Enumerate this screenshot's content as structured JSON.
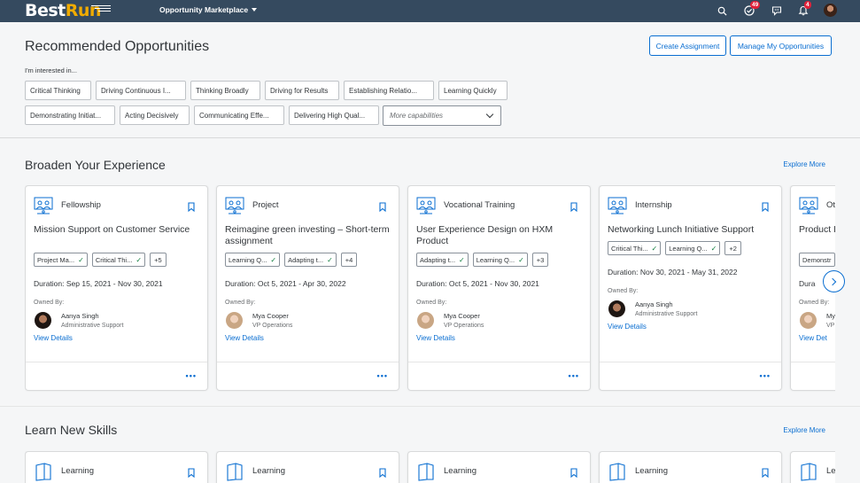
{
  "shell": {
    "logo_best": "Best",
    "logo_run": "Run",
    "app_title": "Opportunity Marketplace",
    "tasks_badge": "49",
    "notifications_badge": "4"
  },
  "recommended": {
    "title": "Recommended Opportunities",
    "create_label": "Create Assignment",
    "manage_label": "Manage My Opportunities",
    "interest_label": "I'm interested in...",
    "chips": [
      "Critical Thinking",
      "Driving Continuous I...",
      "Thinking Broadly",
      "Driving for Results",
      "Establishing Relatio...",
      "Learning Quickly",
      "Demonstrating Initiat...",
      "Acting Decisively",
      "Communicating Effe...",
      "Delivering High Qual..."
    ],
    "more_placeholder": "More capabilities"
  },
  "broaden": {
    "title": "Broaden Your Experience",
    "explore_label": "Explore More",
    "cards": [
      {
        "type": "Fellowship",
        "title": "Mission Support on Customer Service",
        "tags": [
          "Project Ma...",
          "Critical Thi..."
        ],
        "more": "+5",
        "duration": "Duration: Sep 15, 2021 - Nov 30, 2021",
        "owned_by": "Owned By:",
        "owner": "Aanya Singh",
        "role": "Administrative Support",
        "view": "View Details"
      },
      {
        "type": "Project",
        "title": "Reimagine green investing – Short-term assignment",
        "tags": [
          "Learning Q...",
          "Adapting t..."
        ],
        "more": "+4",
        "duration": "Duration: Oct 5, 2021 - Apr 30, 2022",
        "owned_by": "Owned By:",
        "owner": "Mya Cooper",
        "role": "VP Operations",
        "view": "View Details"
      },
      {
        "type": "Vocational Training",
        "title": "User Experience Design on HXM Product",
        "tags": [
          "Adapting t...",
          "Learning Q..."
        ],
        "more": "+3",
        "duration": "Duration: Oct 5, 2021 - Nov 30, 2021",
        "owned_by": "Owned By:",
        "owner": "Mya Cooper",
        "role": "VP Operations",
        "view": "View Details"
      },
      {
        "type": "Internship",
        "title": "Networking Lunch Initiative Support",
        "tags": [
          "Critical Thi...",
          "Learning Q..."
        ],
        "more": "+2",
        "duration": "Duration: Nov 30, 2021 - May 31, 2022",
        "owned_by": "Owned By:",
        "owner": "Aanya Singh",
        "role": "Administrative Support",
        "view": "View Details"
      },
      {
        "type": "Ot",
        "title": "Product Initiative",
        "tags": [
          "Demonstr"
        ],
        "more": "",
        "duration": "Dura",
        "owned_by": "Owned By:",
        "owner": "My",
        "role": "VP",
        "view": "View Det"
      }
    ]
  },
  "learn": {
    "title": "Learn New Skills",
    "explore_label": "Explore More",
    "cards": [
      {
        "type": "Learning"
      },
      {
        "type": "Learning"
      },
      {
        "type": "Learning"
      },
      {
        "type": "Learning"
      },
      {
        "type": "Le"
      }
    ]
  },
  "colors": {
    "shell": "#354a5f",
    "accent": "#0a6ed1",
    "brand_run": "#f0ab00",
    "check": "#107e3e",
    "badge": "#e0213a"
  }
}
